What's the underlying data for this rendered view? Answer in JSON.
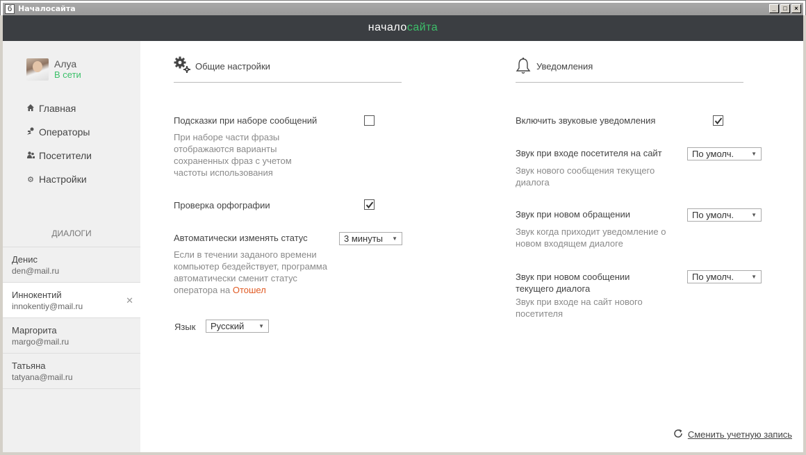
{
  "window": {
    "title": "Началосайта"
  },
  "logo": {
    "part1": "начало",
    "part2": "сайта"
  },
  "user": {
    "name": "Алуа",
    "status": "В сети"
  },
  "nav": [
    {
      "label": "Главная",
      "icon": "home-icon"
    },
    {
      "label": "Операторы",
      "icon": "operators-icon"
    },
    {
      "label": "Посетители",
      "icon": "visitors-icon"
    },
    {
      "label": "Настройки",
      "icon": "gear-icon"
    }
  ],
  "dialogs": {
    "heading": "ДИАЛОГИ",
    "items": [
      {
        "name": "Денис",
        "email": "den@mail.ru",
        "active": false
      },
      {
        "name": "Иннокентий",
        "email": "innokentiy@mail.ru",
        "active": true
      },
      {
        "name": "Маргорита",
        "email": "margo@mail.ru",
        "active": false
      },
      {
        "name": "Татьяна",
        "email": "tatyana@mail.ru",
        "active": false
      }
    ]
  },
  "general": {
    "title": "Общие настройки",
    "hints_label": "Подсказки при наборе сообщений",
    "hints_checked": false,
    "hints_desc": "При наборе части фразы отображаются варианты сохраненных фраз с учетом частоты использования",
    "spell_label": "Проверка орфографии",
    "spell_checked": true,
    "auto_status_label": "Автоматически изменять статус",
    "auto_status_value": "3 минуты",
    "auto_status_desc": "Если в течении заданого времени компьютер бездействует, программа автоматически сменит статус оператора на",
    "auto_status_away": "Отошел",
    "lang_label": "Язык",
    "lang_value": "Русский"
  },
  "notifications": {
    "title": "Уведомления",
    "sound_label": "Включить звуковые уведомления",
    "sound_checked": true,
    "enter_label": "Звук при входе посетителя на сайт",
    "enter_value": "По умолч.",
    "enter_desc": "Звук нового сообщения текущего диалога",
    "new_label": "Звук при новом обращении",
    "new_value": "По умолч.",
    "new_desc": "Звук когда приходит уведомление о новом входящем диалоге",
    "msg_label": "Звук при новом сообщении текущего диалога",
    "msg_value": "По умолч.",
    "msg_desc": "Звук при входе на сайт нового посетителя"
  },
  "footer": {
    "switch_account": "Сменить учетную запись"
  },
  "colors": {
    "accent": "#3cc06a",
    "away": "#e05a23",
    "topbar": "#3b3e42"
  }
}
